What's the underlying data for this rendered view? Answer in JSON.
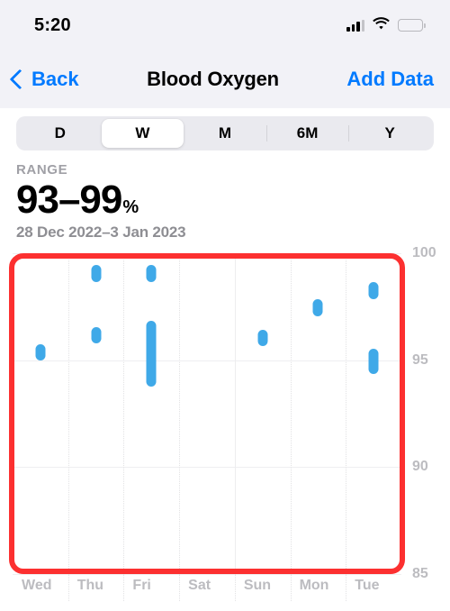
{
  "status_bar": {
    "time": "5:20",
    "signal_icon": "cellular-signal-icon",
    "wifi_icon": "wifi-icon",
    "battery_icon": "battery-icon"
  },
  "nav": {
    "back_label": "Back",
    "title": "Blood Oxygen",
    "action_label": "Add Data",
    "accent_color": "#007AFF"
  },
  "segmented_control": {
    "options": [
      {
        "label": "D",
        "selected": false
      },
      {
        "label": "W",
        "selected": true
      },
      {
        "label": "M",
        "selected": false
      },
      {
        "label": "6M",
        "selected": false
      },
      {
        "label": "Y",
        "selected": false
      }
    ]
  },
  "summary": {
    "label": "RANGE",
    "value": "93–99",
    "unit": "%",
    "date_range": "28 Dec 2022–3 Jan 2023"
  },
  "annotation": {
    "color": "#FC3030",
    "shape": "rounded-rectangle-highlight"
  },
  "chart_data": {
    "type": "scatter",
    "title": "Blood Oxygen",
    "xlabel": "",
    "ylabel": "%",
    "ylim": [
      85,
      100
    ],
    "yticks": [
      100,
      95,
      90,
      85
    ],
    "categories": [
      "Wed",
      "Thu",
      "Fri",
      "Sat",
      "Sun",
      "Mon",
      "Tue"
    ],
    "grid": true,
    "legend": "none",
    "series_color": "#3FA9E8",
    "points": [
      {
        "day": "Wed",
        "low": 95.2,
        "high": 95.5
      },
      {
        "day": "Thu",
        "low": 98.9,
        "high": 99.2
      },
      {
        "day": "Thu",
        "low": 96.0,
        "high": 96.3
      },
      {
        "day": "Fri",
        "low": 98.9,
        "high": 99.2
      },
      {
        "day": "Fri",
        "low": 94.0,
        "high": 96.6
      },
      {
        "day": "Sat",
        "low": null,
        "high": null
      },
      {
        "day": "Sun",
        "low": 95.9,
        "high": 96.2
      },
      {
        "day": "Mon",
        "low": 97.3,
        "high": 97.6
      },
      {
        "day": "Tue",
        "low": 98.1,
        "high": 98.4
      },
      {
        "day": "Tue",
        "low": 94.6,
        "high": 95.3
      }
    ]
  }
}
